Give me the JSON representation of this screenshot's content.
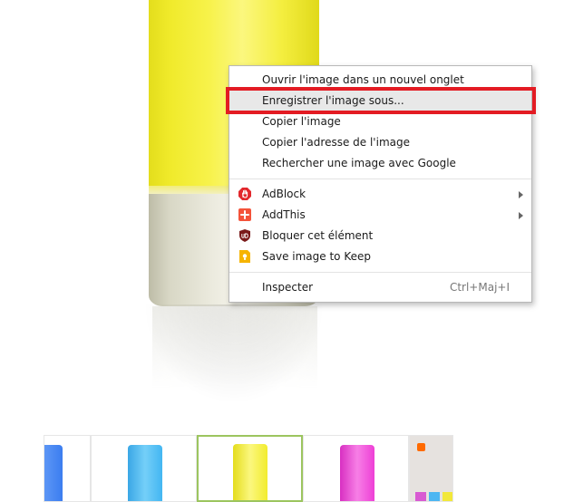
{
  "context_menu": {
    "items": [
      {
        "label": "Ouvrir l'image dans un nouvel onglet"
      },
      {
        "label": "Enregistrer l'image sous..."
      },
      {
        "label": "Copier l'image"
      },
      {
        "label": "Copier l'adresse de l'image"
      },
      {
        "label": "Rechercher une image avec Google"
      }
    ],
    "extensions": [
      {
        "label": "AdBlock",
        "icon": "adblock-icon",
        "color": "#e2282d",
        "has_submenu": true
      },
      {
        "label": "AddThis",
        "icon": "addthis-icon",
        "color": "#f4533a",
        "has_submenu": true
      },
      {
        "label": "Bloquer cet élément",
        "icon": "ublock-icon",
        "color": "#7a1a1a",
        "has_submenu": false
      },
      {
        "label": "Save image to Keep",
        "icon": "keep-icon",
        "color": "#f6b400",
        "has_submenu": false
      }
    ],
    "inspect": {
      "label": "Inspecter",
      "shortcut": "Ctrl+Maj+I"
    },
    "highlight_color": "#e31b23"
  },
  "thumbnails": [
    {
      "color": "#3b7df0"
    },
    {
      "color": "#43b6f2"
    },
    {
      "color": "#f2ec2e",
      "selected": true
    },
    {
      "color": "#ee3fd6"
    },
    {
      "color": "#e6e2df"
    }
  ],
  "thumbnail_selected_border": "#9cc55f"
}
